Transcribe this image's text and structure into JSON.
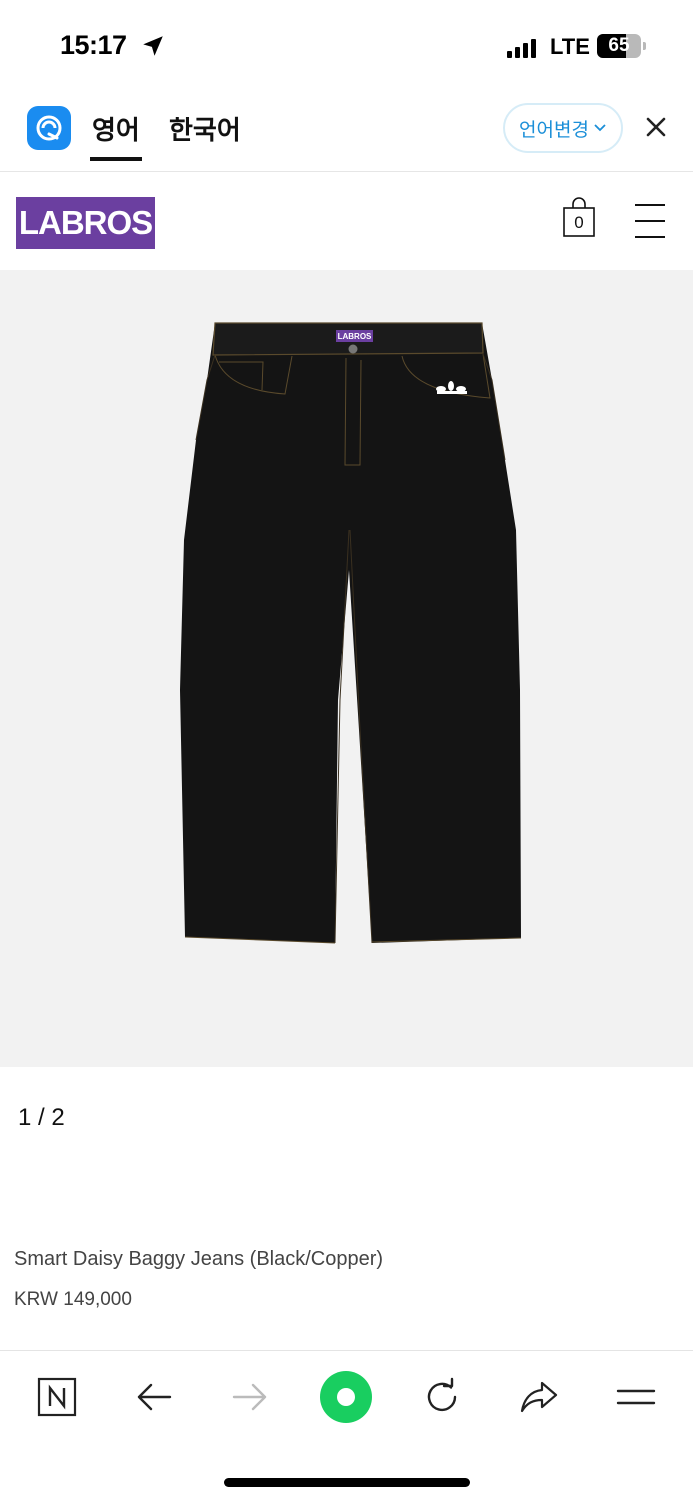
{
  "status_bar": {
    "time": "15:17",
    "network": "LTE",
    "battery": "65",
    "battery_level": 0.65,
    "icons": [
      "location-arrow-icon",
      "signal-icon",
      "battery-icon"
    ]
  },
  "translate_bar": {
    "logo_icon": "papago-icon",
    "tab_english": "영어",
    "tab_korean": "한국어",
    "change_language": "언어변경",
    "close_icon": "close-icon",
    "accent_color": "#1b8fd8"
  },
  "site_header": {
    "logo": "LABROS",
    "logo_color": "#6b3fa0",
    "cart_count": "0",
    "icons": [
      "shopping-bag-icon",
      "hamburger-menu-icon"
    ]
  },
  "product": {
    "image_label": "LABROS",
    "image_counter": "1 / 2",
    "name": "Smart Daisy Baggy Jeans (Black/Copper)",
    "price": "KRW 149,000"
  },
  "bottom_toolbar": {
    "items": [
      "naver-n-icon",
      "back-arrow-icon",
      "forward-arrow-icon",
      "green-dot-icon",
      "reload-icon",
      "share-icon",
      "menu-icon"
    ],
    "accent_color": "#19ce60"
  }
}
